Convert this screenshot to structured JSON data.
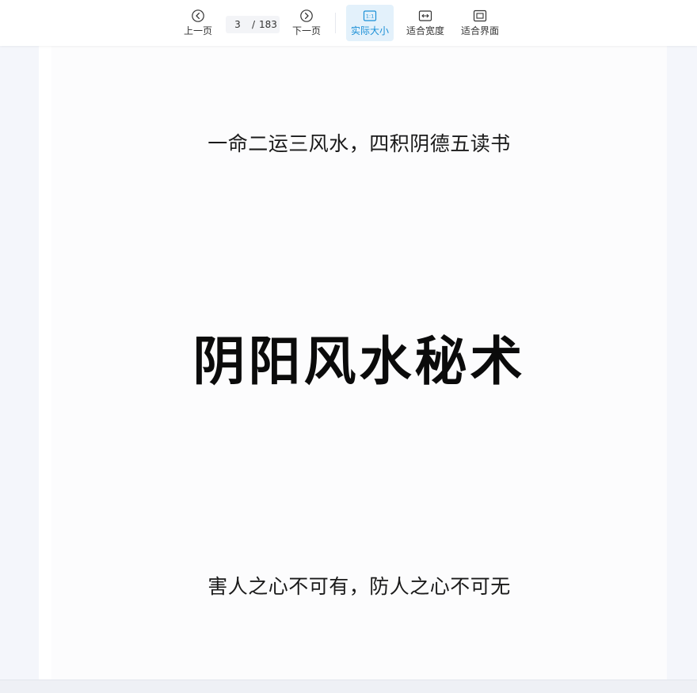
{
  "toolbar": {
    "prev_label": "上一页",
    "next_label": "下一页",
    "current_page": "3",
    "separator": "/",
    "total_pages": "183",
    "actual_size_label": "实际大小",
    "actual_size_icon_text": "1:1",
    "fit_width_label": "适合宽度",
    "fit_screen_label": "适合界面",
    "active_mode": "实际大小",
    "accent_color": "#1a8fd6",
    "icons": {
      "prev": "chevron-left-circle-icon",
      "next": "chevron-right-circle-icon",
      "actual_size": "actual-size-icon",
      "fit_width": "fit-width-icon",
      "fit_screen": "fit-screen-icon"
    }
  },
  "document": {
    "top_line": "一命二运三风水，四积阴德五读书",
    "title": "阴阳风水秘术",
    "bottom_line": "害人之心不可有，防人之心不可无"
  }
}
